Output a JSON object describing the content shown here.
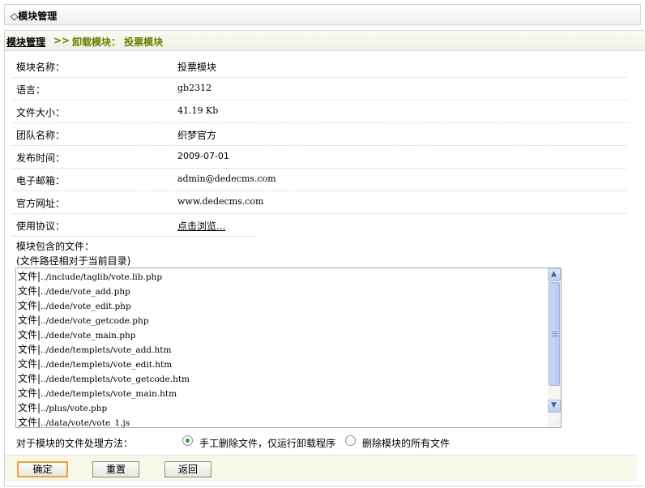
{
  "header": {
    "title": "◇模块管理"
  },
  "breadcrumb": {
    "home": "模块管理",
    "separator": ">>",
    "page": "卸载模块：  投票模块"
  },
  "info_rows": [
    {
      "label": "模块名称：",
      "value": "投票模块"
    },
    {
      "label": "语言：",
      "value": "gb2312"
    },
    {
      "label": "文件大小：",
      "value": "41.19 Kb"
    },
    {
      "label": "团队名称：",
      "value": "织梦官方"
    },
    {
      "label": "发布时间：",
      "value": "2009-07-01"
    },
    {
      "label": "电子邮箱：",
      "value": "admin@dedecms.com"
    },
    {
      "label": "官方网址：",
      "value": "www.dedecms.com"
    },
    {
      "label": "使用协议：",
      "value": "点击浏览..."
    }
  ],
  "files": {
    "label": "模块包含的文件：",
    "note": "(文件路径相对于当前目录)",
    "prefix": "文件|",
    "items": [
      "../include/taglib/vote.lib.php",
      "../dede/vote_add.php",
      "../dede/vote_edit.php",
      "../dede/vote_getcode.php",
      "../dede/vote_main.php",
      "../dede/templets/vote_add.htm",
      "../dede/templets/vote_edit.htm",
      "../dede/templets/vote_getcode.htm",
      "../dede/templets/vote_main.htm",
      "../plus/vote.php",
      "../data/vote/vote_1.js"
    ]
  },
  "method": {
    "label": "对于模块的文件处理方法：",
    "options": [
      {
        "label": "手工删除文件，仅运行卸载程序",
        "selected": true
      },
      {
        "label": "删除模块的所有文件",
        "selected": false
      }
    ]
  },
  "buttons": {
    "confirm": "确定",
    "reset": "重置",
    "back": "返回"
  },
  "colors": {
    "accent": "#6b7d00",
    "focus": "#f0a040"
  }
}
